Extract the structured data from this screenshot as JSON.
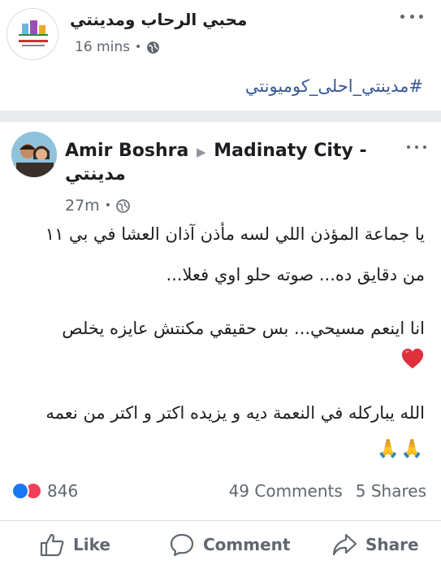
{
  "outer_post": {
    "page_name": "محبي الرحاب ومدينتي",
    "time": "16 mins",
    "separator": "•",
    "hashtag": "#مدينتي_احلى_كوميونتي"
  },
  "shared_post": {
    "author": "Amir Boshra",
    "target_group": "Madinaty City -",
    "target_group_line2": "مدينتي",
    "time": "27m",
    "separator": "•",
    "body_lines": [
      "يا جماعة المؤذن اللي لسه مأذن آذان العشا في بي ١١",
      "من دقايق ده... صوته حلو اوي فعلا...",
      "انا اينعم مسيحي... بس حقيقي مكنتش عايزه يخلص",
      "الله يباركله في النعمة ديه و يزيده اكتر و اكتر من نعمه"
    ],
    "emoji_after_line3": "red-heart",
    "emoji_after_line4": "🙏🙏"
  },
  "stats": {
    "reaction_count": "846",
    "comments": "49 Comments",
    "shares": "5 Shares"
  },
  "actions": {
    "like": "Like",
    "comment": "Comment",
    "share": "Share"
  },
  "colors": {
    "link_blue": "#385898",
    "like_blue": "#1877f2",
    "love_red": "#f33e58",
    "meta_gray": "#606770",
    "divider": "#e9ebee"
  }
}
